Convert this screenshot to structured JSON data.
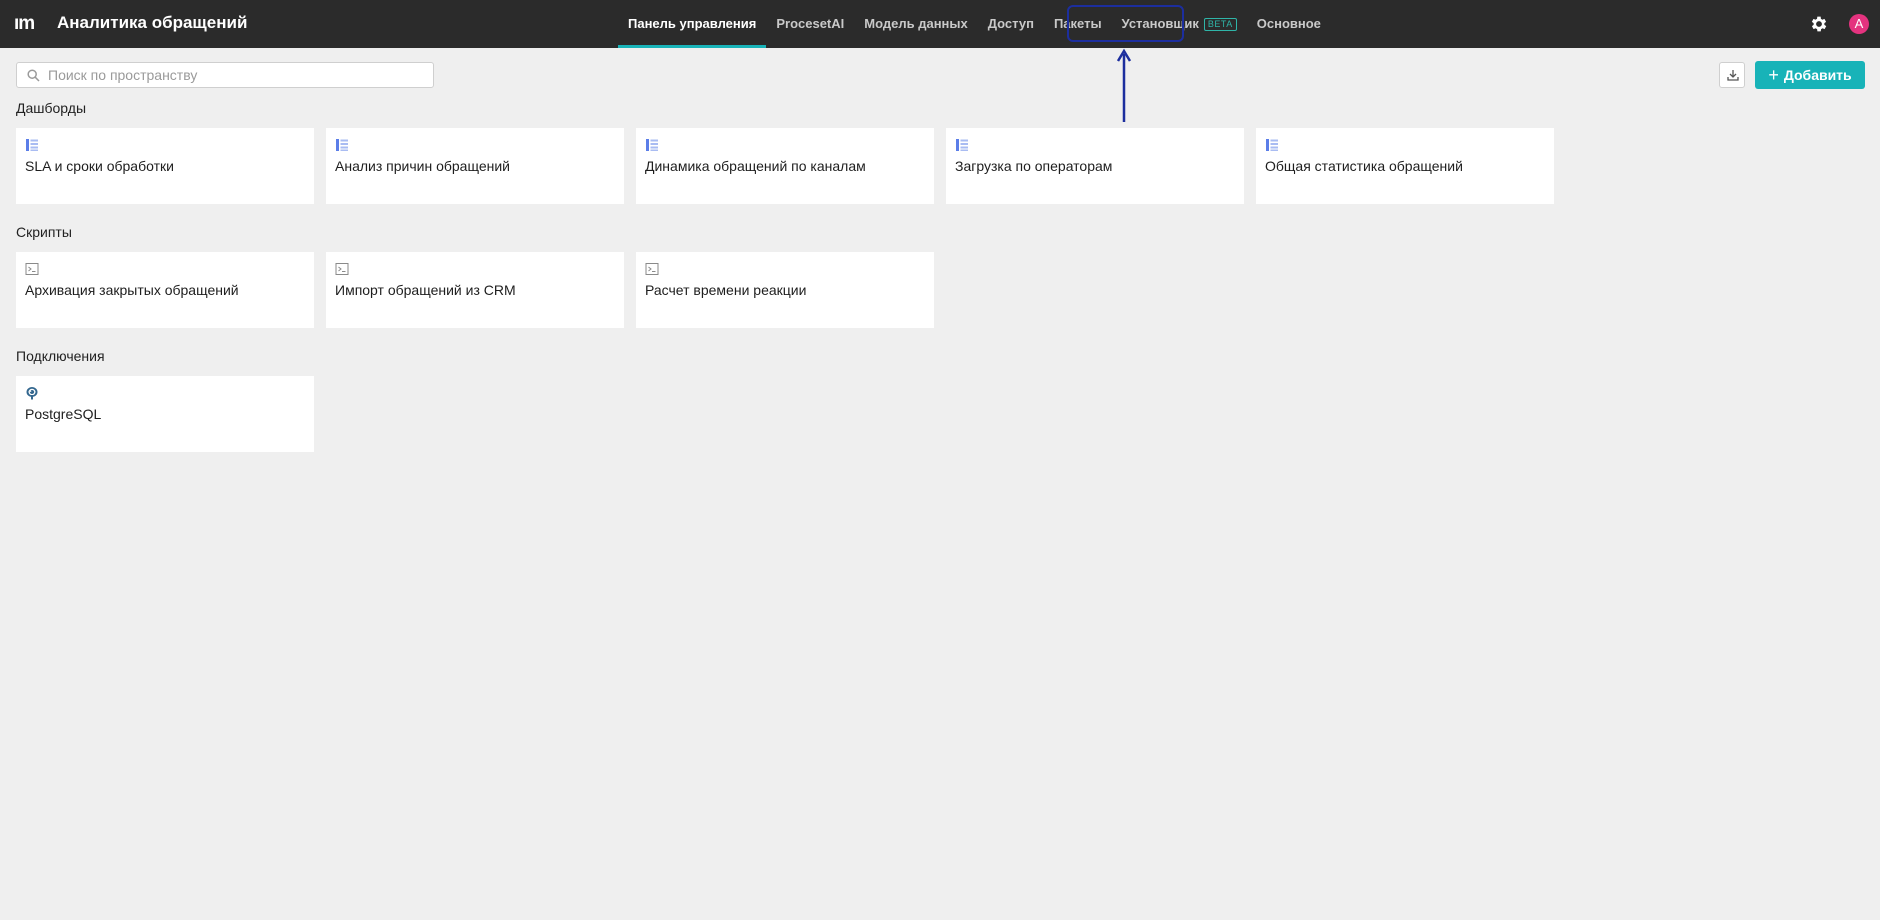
{
  "header": {
    "logo": "ım",
    "title": "Аналитика обращений",
    "tabs": [
      {
        "label": "Панель управления",
        "active": true
      },
      {
        "label": "ProcesetAI"
      },
      {
        "label": "Модель данных"
      },
      {
        "label": "Доступ"
      },
      {
        "label": "Пакеты"
      },
      {
        "label": "Установщик",
        "badge": "BETA"
      },
      {
        "label": "Основное"
      }
    ],
    "avatar_letter": "A",
    "accent_color": "#18b3b8"
  },
  "toolbar": {
    "search_placeholder": "Поиск по пространству",
    "search_value": "",
    "add_label": "Добавить"
  },
  "sections": {
    "dashboards": {
      "title": "Дашборды",
      "icon": "dashboard-icon",
      "items": [
        {
          "label": "SLA и сроки обработки"
        },
        {
          "label": "Анализ причин обращений"
        },
        {
          "label": "Динамика обращений по каналам"
        },
        {
          "label": "Загрузка по операторам"
        },
        {
          "label": "Общая статистика обращений"
        }
      ]
    },
    "scripts": {
      "title": "Скрипты",
      "icon": "script-icon",
      "items": [
        {
          "label": "Архивация закрытых обращений"
        },
        {
          "label": "Импорт обращений из CRM"
        },
        {
          "label": "Расчет времени реакции"
        }
      ]
    },
    "connections": {
      "title": "Подключения",
      "icon": "postgresql-icon",
      "items": [
        {
          "label": "PostgreSQL"
        }
      ]
    }
  }
}
